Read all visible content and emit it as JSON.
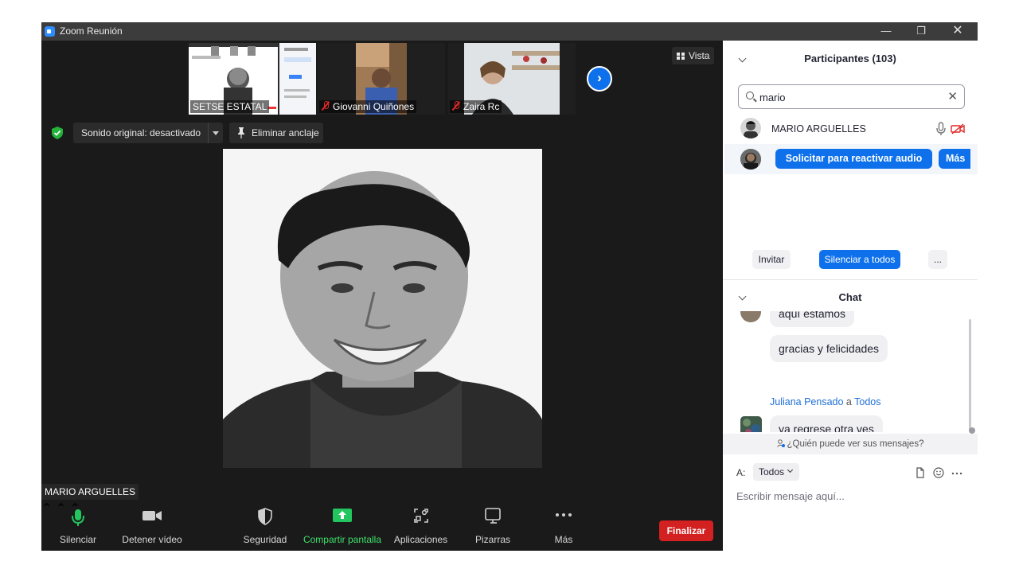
{
  "window": {
    "title": "Zoom Reunión"
  },
  "thumbnails": [
    {
      "name": "SETSE ESTATAL",
      "muted": false
    },
    {
      "name": "Giovanni Quiñones",
      "muted": true
    },
    {
      "name": "Zaira Rc",
      "muted": true
    }
  ],
  "view_button": "Vista",
  "original_sound": "Sonido original: desactivado",
  "unpin": "Eliminar anclaje",
  "active_speaker": "MARIO ARGUELLES",
  "toolbar": {
    "mute": "Silenciar",
    "video": "Detener vídeo",
    "security": "Seguridad",
    "share": "Compartir pantalla",
    "apps": "Aplicaciones",
    "whiteboards": "Pizarras",
    "more": "Más",
    "end": "Finalizar"
  },
  "participants": {
    "title": "Participantes (103)",
    "search_value": "mario",
    "items": [
      {
        "name": "MARIO ARGUELLES"
      }
    ],
    "request_unmute": "Solicitar para reactivar audio",
    "more": "Más",
    "invite": "Invitar",
    "mute_all": "Silenciar a todos",
    "ellipsis": "..."
  },
  "chat": {
    "title": "Chat",
    "messages": [
      {
        "text": "aquí estamos"
      },
      {
        "text": "gracias y felicidades"
      }
    ],
    "sender": "Juliana Pensado",
    "to_word": "a",
    "recipient": "Todos",
    "last_message": "ya regrese otra ves",
    "who_can_see": "¿Quién puede ver sus mensajes?",
    "to_label": "A:",
    "to_value": "Todos",
    "placeholder": "Escribir mensaje aquí..."
  },
  "colors": {
    "accent": "#0e71eb",
    "end": "#d32020",
    "share": "#22c55e"
  }
}
